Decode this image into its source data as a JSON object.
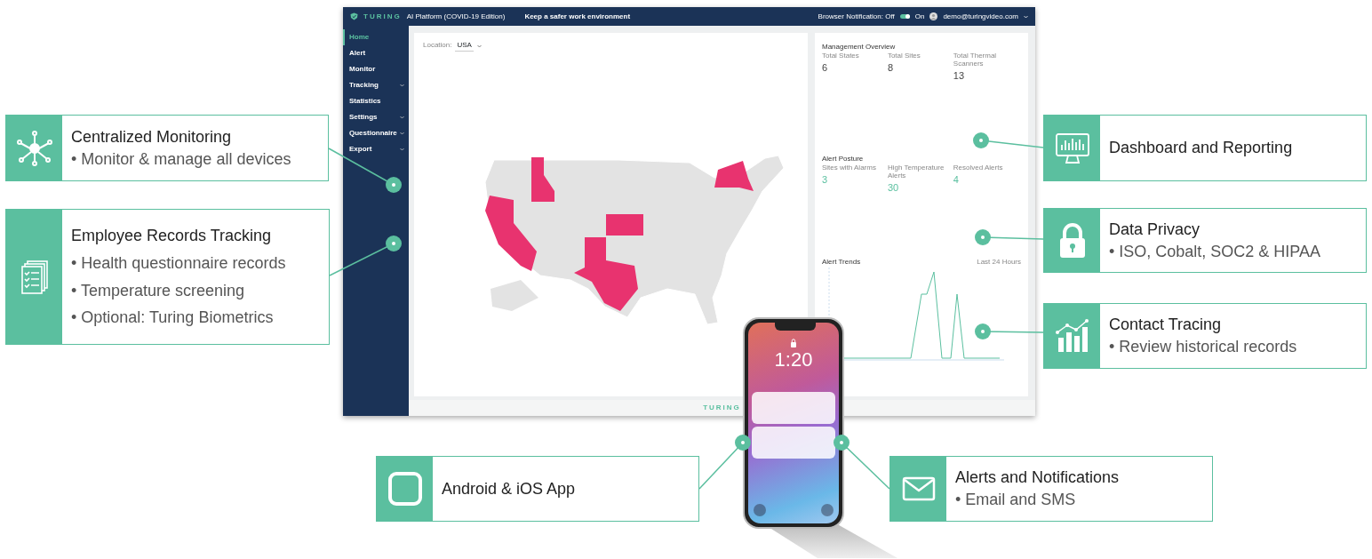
{
  "header": {
    "logo": "TURING",
    "product": "AI Platform (COVID-19 Edition)",
    "tagline": "Keep a safer work environment",
    "notification_label": "Browser Notification: Off",
    "notification_on_label": "On",
    "notifications_on": true,
    "user": "demo@turingvideo.com"
  },
  "sidebar": {
    "items": [
      {
        "label": "Home",
        "selected": true,
        "expandable": false
      },
      {
        "label": "Alert",
        "selected": false,
        "expandable": false
      },
      {
        "label": "Monitor",
        "selected": false,
        "expandable": false
      },
      {
        "label": "Tracking",
        "selected": false,
        "expandable": true
      },
      {
        "label": "Statistics",
        "selected": false,
        "expandable": false
      },
      {
        "label": "Settings",
        "selected": false,
        "expandable": true
      },
      {
        "label": "Questionnaire",
        "selected": false,
        "expandable": true
      },
      {
        "label": "Export",
        "selected": false,
        "expandable": true
      }
    ]
  },
  "location": {
    "label": "Location:",
    "value": "USA"
  },
  "overview": {
    "title": "Management Overview",
    "stats": [
      {
        "label": "Total States",
        "value": "6"
      },
      {
        "label": "Total Sites",
        "value": "8"
      },
      {
        "label": "Total Thermal Scanners",
        "value": "13"
      }
    ]
  },
  "alert_posture": {
    "title": "Alert Posture",
    "stats": [
      {
        "label": "Sites with Alarms",
        "value": "3"
      },
      {
        "label": "High Temperature Alerts",
        "value": "30"
      },
      {
        "label": "Resolved Alerts",
        "value": "4"
      }
    ]
  },
  "alert_trends": {
    "title": "Alert Trends",
    "range": "Last 24 Hours"
  },
  "footer": {
    "logo": "TURING"
  },
  "phone": {
    "time": "1:20"
  },
  "callouts": [
    {
      "kind": "network",
      "title": "Centralized Monitoring",
      "lines": [
        "• Monitor & manage all devices"
      ]
    },
    {
      "kind": "documents",
      "title": "Employee Records Tracking",
      "lines": [
        "• Health questionnaire records",
        "• Temperature screening",
        "• Optional: Turing Biometrics"
      ]
    },
    {
      "kind": "monitor",
      "title": "Dashboard and Reporting"
    },
    {
      "kind": "padlock",
      "title": "Data Privacy",
      "lines": [
        "• ISO, Cobalt, SOC2 & HIPAA"
      ]
    },
    {
      "kind": "barchart",
      "title": "Contact Tracing",
      "lines": [
        "• Review historical records"
      ]
    },
    {
      "kind": "app",
      "title": "Android & iOS App"
    },
    {
      "kind": "envelope",
      "title": "Alerts and Notifications",
      "lines": [
        "• Email and SMS"
      ]
    }
  ]
}
